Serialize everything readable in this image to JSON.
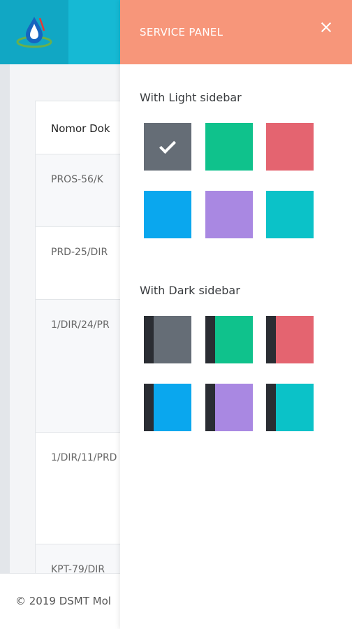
{
  "table": {
    "header": "Nomor Dok",
    "rows": [
      "PROS-56/K",
      "PRD-25/DIR",
      "1/DIR/24/PR",
      "1/DIR/11/PRD",
      "KPT-79/DIR"
    ]
  },
  "footer": {
    "text": "© 2019 DSMT Mol"
  },
  "panel": {
    "title": "SERVICE PANEL",
    "light_label": "With Light sidebar",
    "dark_label": "With Dark sidebar",
    "light_swatches": [
      {
        "name": "gray",
        "color": "#656d76",
        "selected": true
      },
      {
        "name": "green",
        "color": "#0fc28c",
        "selected": false
      },
      {
        "name": "red",
        "color": "#e46470",
        "selected": false
      },
      {
        "name": "blue",
        "color": "#0aa7ee",
        "selected": false
      },
      {
        "name": "purple",
        "color": "#a988e2",
        "selected": false
      },
      {
        "name": "cyan",
        "color": "#0bc2c8",
        "selected": false
      }
    ],
    "dark_swatches": [
      {
        "name": "gray",
        "color": "#656d76"
      },
      {
        "name": "green",
        "color": "#0fc28c"
      },
      {
        "name": "red",
        "color": "#e46470"
      },
      {
        "name": "blue",
        "color": "#0aa7ee"
      },
      {
        "name": "purple",
        "color": "#a988e2"
      },
      {
        "name": "cyan",
        "color": "#0bc2c8"
      }
    ],
    "dark_stripe_color": "#2a2d33"
  },
  "colors": {
    "topbar": "#16b9d4",
    "panel_header": "#f7967a"
  }
}
